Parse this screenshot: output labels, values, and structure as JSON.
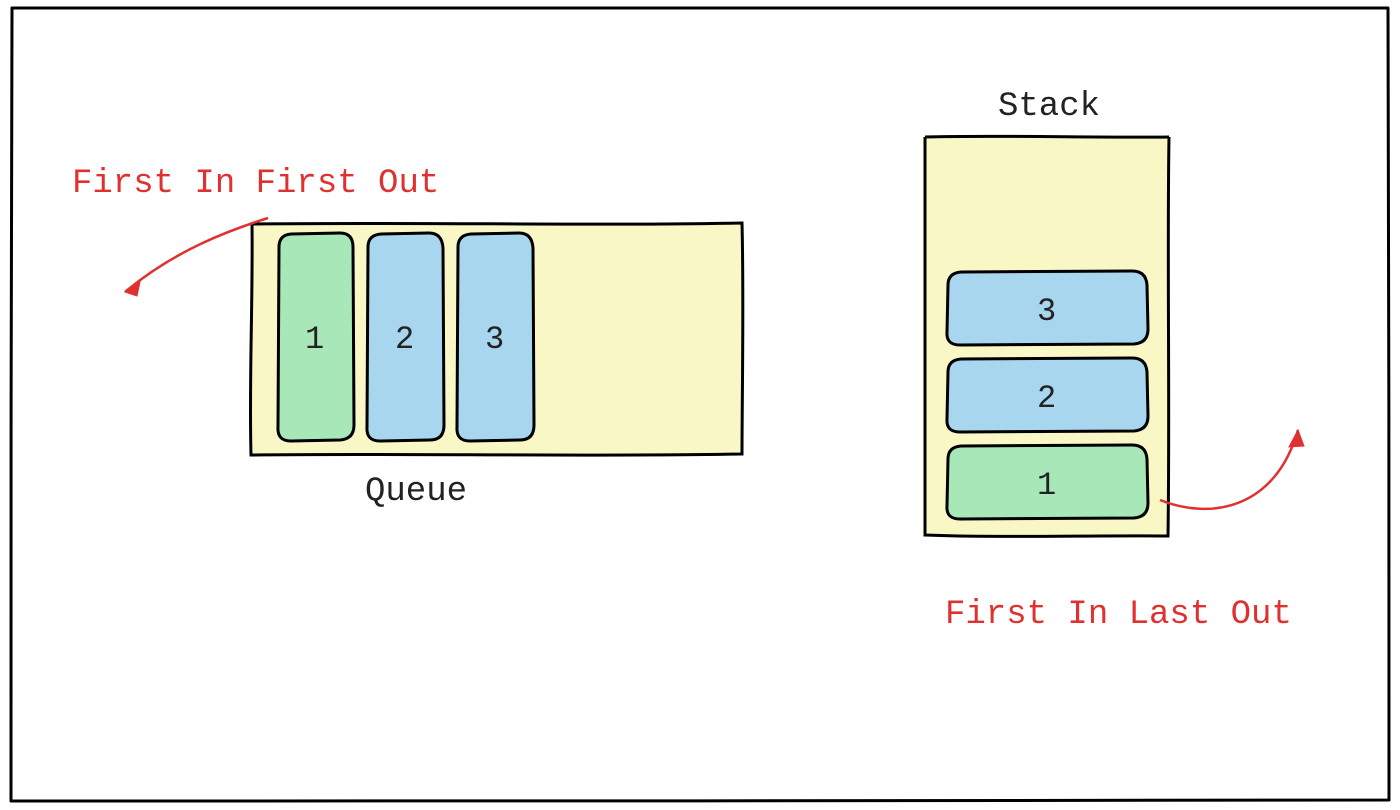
{
  "diagram": {
    "queue": {
      "title": "Queue",
      "principle": "First In First Out",
      "items": [
        "1",
        "2",
        "3"
      ]
    },
    "stack": {
      "title": "Stack",
      "principle": "First In Last Out",
      "items": [
        "1",
        "2",
        "3"
      ]
    },
    "colors": {
      "container": "#f9f7c5",
      "highlight": "#a8e7b8",
      "normal": "#a8d6ee",
      "stroke": "#000000",
      "annotation": "#e03131"
    }
  }
}
